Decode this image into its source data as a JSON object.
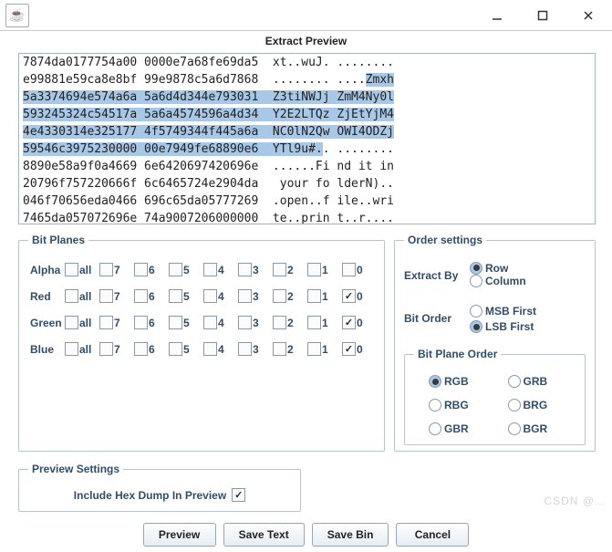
{
  "window": {
    "app_icon": "☕",
    "min": "—",
    "max": "▢",
    "close": "✕"
  },
  "header": "Extract Preview",
  "preview_lines": [
    {
      "hex": "7874da0177754a00 0000e7a68fe69da5",
      "ascii": "xt..wuJ. ........",
      "sel": false
    },
    {
      "hex": "e99881e59ca8e8bf 99e9878c5a6d7868",
      "ascii": "........ ....",
      "sel": false,
      "sel_tail": "Zmxh"
    },
    {
      "hex": "5a3374694e574a6a 5a6d4d344e793031",
      "ascii": "Z3tiNWJj ZmM4Ny0l",
      "sel": true
    },
    {
      "hex": "593245324c54517a 5a6a4574596a4d34",
      "ascii": "Y2E2LTQz ZjEtYjM4",
      "sel": true
    },
    {
      "hex": "4e4330314e325177 4f5749344f445a6a",
      "ascii": "NC0lN2Qw OWI4ODZj",
      "sel": true
    },
    {
      "hex": "59546c3975230000 00e7949fe68890e6",
      "ascii": "YTl9u#.. ........",
      "sel": true,
      "partial": true
    },
    {
      "hex": "8890e58a9f0a4669 6e6420697420696e",
      "ascii": "......Fi nd it in",
      "sel": false
    },
    {
      "hex": "20796f757220666f 6c6465724e2904da",
      "ascii": " your fo lderN)..",
      "sel": false
    },
    {
      "hex": "046f70656eda0466 696c65da05777269",
      "ascii": ".open..f ile..wri",
      "sel": false
    },
    {
      "hex": "7465da057072696e 74a9007206000000",
      "ascii": "te..prin t..r....",
      "sel": false
    }
  ],
  "bit_planes": {
    "legend": "Bit Planes",
    "rows": [
      {
        "label": "Alpha",
        "checks": [
          false,
          false,
          false,
          false,
          false,
          false,
          false,
          false,
          false
        ]
      },
      {
        "label": "Red",
        "checks": [
          false,
          false,
          false,
          false,
          false,
          false,
          false,
          false,
          true
        ]
      },
      {
        "label": "Green",
        "checks": [
          false,
          false,
          false,
          false,
          false,
          false,
          false,
          false,
          true
        ]
      },
      {
        "label": "Blue",
        "checks": [
          false,
          false,
          false,
          false,
          false,
          false,
          false,
          false,
          true
        ]
      }
    ],
    "cols": [
      "all",
      "7",
      "6",
      "5",
      "4",
      "3",
      "2",
      "1",
      "0"
    ]
  },
  "order": {
    "legend": "Order settings",
    "extract_by": {
      "label": "Extract By",
      "opts": [
        "Row",
        "Column"
      ],
      "sel": 0
    },
    "bit_order": {
      "label": "Bit Order",
      "opts": [
        "MSB First",
        "LSB First"
      ],
      "sel": 1
    },
    "bpo": {
      "legend": "Bit Plane Order",
      "opts": [
        "RGB",
        "GRB",
        "RBG",
        "BRG",
        "GBR",
        "BGR"
      ],
      "sel": 0
    }
  },
  "preview_settings": {
    "legend": "Preview Settings",
    "label": "Include Hex Dump In Preview",
    "checked": true
  },
  "buttons": [
    "Preview",
    "Save Text",
    "Save Bin",
    "Cancel"
  ],
  "watermark": "CSDN @..."
}
